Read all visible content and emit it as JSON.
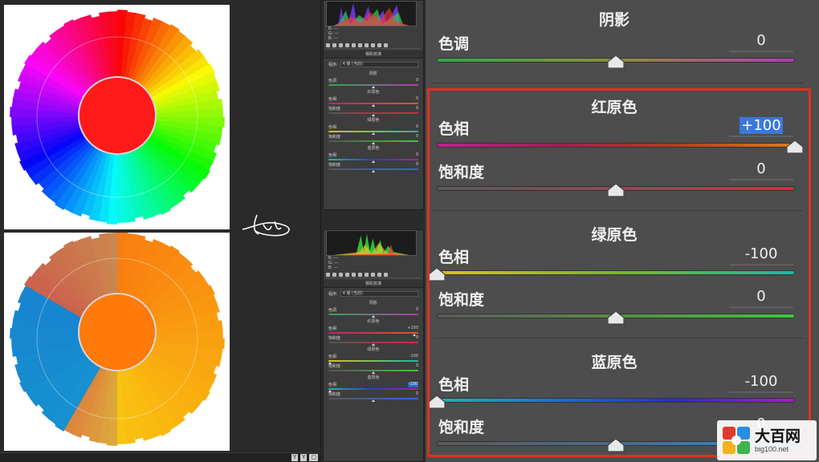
{
  "shadows": {
    "title": "阴影",
    "hue_label": "色调",
    "hue_value": "0"
  },
  "red_primary": {
    "title": "红原色",
    "hue_label": "色相",
    "hue_value": "+100",
    "saturation_label": "饱和度",
    "saturation_value": "0"
  },
  "green_primary": {
    "title": "绿原色",
    "hue_label": "色相",
    "hue_value": "-100",
    "saturation_label": "饱和度",
    "saturation_value": "0"
  },
  "blue_primary": {
    "title": "蓝原色",
    "hue_label": "色相",
    "hue_value": "-100",
    "saturation_label": "饱和度",
    "saturation_value": "0"
  },
  "sliders": {
    "shadows_hue": 0,
    "red_hue": 100,
    "red_saturation": 0,
    "green_hue": -100,
    "green_saturation": 0,
    "blue_hue": -100,
    "blue_saturation": 0
  },
  "mini_panel_1": {
    "rgb_lines": [
      "R: ---",
      "G: ---",
      "B: ---"
    ],
    "title": "相机校准",
    "process_label": "程序:",
    "process_value": "4 版 (当前)",
    "shadows_title": "阴影",
    "shadows_hue_label": "色调",
    "shadows_hue_value": "0",
    "red_title": "红原色",
    "red_hue_label": "色相",
    "red_hue_value": "0",
    "red_sat_label": "饱和度",
    "red_sat_value": "0",
    "green_title": "绿原色",
    "green_hue_label": "色相",
    "green_hue_value": "0",
    "green_sat_label": "饱和度",
    "green_sat_value": "0",
    "blue_title": "蓝原色",
    "blue_hue_label": "色相",
    "blue_hue_value": "0",
    "blue_sat_label": "饱和度",
    "blue_sat_value": "0"
  },
  "mini_panel_2": {
    "rgb_lines": [
      "R: ---",
      "G: ---",
      "B: ---"
    ],
    "title": "相机校准",
    "process_label": "程序:",
    "process_value": "4 版 (当前)",
    "shadows_title": "阴影",
    "shadows_hue_label": "色调",
    "shadows_hue_value": "0",
    "red_title": "红原色",
    "red_hue_label": "色相",
    "red_hue_value": "+100",
    "red_sat_label": "饱和度",
    "red_sat_value": "0",
    "green_title": "绿原色",
    "green_hue_label": "色相",
    "green_hue_value": "-100",
    "green_sat_label": "饱和度",
    "green_sat_value": "0",
    "blue_title": "蓝原色",
    "blue_hue_label": "色相",
    "blue_hue_value": "-100",
    "blue_sat_label": "饱和度",
    "blue_sat_value": "0"
  },
  "canvas_controls": [
    "Y",
    "Y",
    "▢"
  ],
  "watermark": {
    "main": "大百网",
    "sub": "big100.net"
  },
  "colors": {
    "highlight_border": "#e0301e",
    "selection_blue": "#3b78d8",
    "panel_bg": "#4d4d4d"
  },
  "icons": [
    "signature-icon",
    "logo-icon",
    "thumb-icon"
  ]
}
